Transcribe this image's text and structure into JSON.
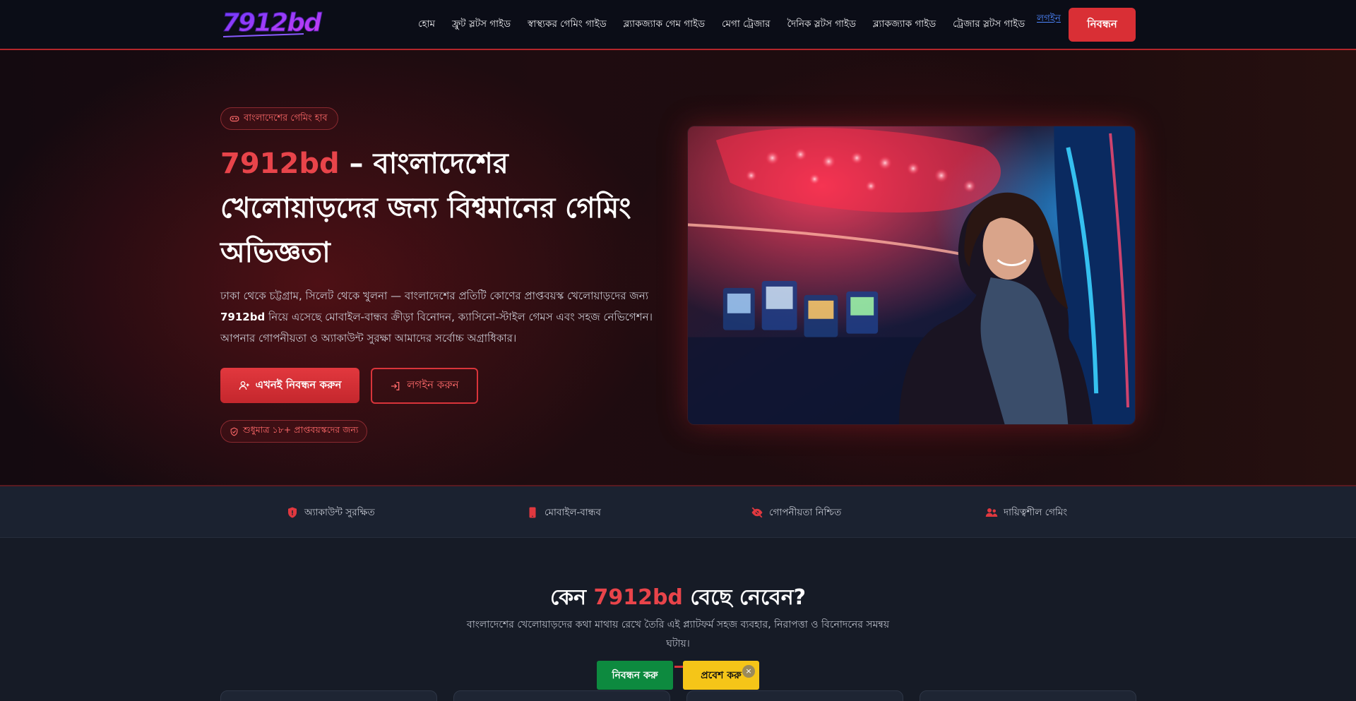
{
  "brand": {
    "logo_text": "7912bd",
    "colors": {
      "accent": "#d92f35",
      "logo_start": "#7a3cff",
      "logo_end": "#c23bff"
    }
  },
  "nav": {
    "links": [
      "হোম",
      "ফ্রুট স্লটস গাইড",
      "স্বাস্থ্যকর গেমিং গাইড",
      "ব্ল্যাকজ্যাক গেম গাইড",
      "মেগা ট্রেজার",
      "দৈনিক স্লটস গাইড",
      "ব্ল্যাকজ্যাক গাইড",
      "ট্রেজার স্লটস গাইড"
    ],
    "login_label": "লগইন",
    "register_label": "নিবন্ধন"
  },
  "hero": {
    "badge": "বাংলাদেশের গেমিং হাব",
    "badge_icon": "gamepad-icon",
    "title_brand": "7912bd",
    "title_rest_1": " – বাংলাদেশের",
    "title_rest_2": "খেলোয়াড়দের জন্য বিশ্বমানের গেমিং",
    "title_rest_3": "অভিজ্ঞতা",
    "desc_before": "ঢাকা থেকে চট্টগ্রাম, সিলেট থেকে খুলনা — বাংলাদেশের প্রতিটি কোণের প্রাপ্তবয়স্ক খেলোয়াড়দের জন্য ",
    "desc_brand": "7912bd",
    "desc_after": " নিয়ে এসেছে মোবাইল-বান্ধব ক্রীড়া বিনোদন, ক্যাসিনো-স্টাইল গেমস এবং সহজ নেভিগেশন। আপনার গোপনীয়তা ও অ্যাকাউন্ট সুরক্ষা আমাদের সর্বোচ্চ অগ্রাধিকার।",
    "primary_button": "এখনই নিবন্ধন করুন",
    "outline_button": "লগইন করুন",
    "age_badge": "শুধুমাত্র ১৮+ প্রাপ্তবয়স্কদের জন্য"
  },
  "features": [
    {
      "label": "অ্যাকাউন্ট সুরক্ষিত",
      "icon": "shield-icon"
    },
    {
      "label": "মোবাইল-বান্ধব",
      "icon": "mobile-icon"
    },
    {
      "label": "গোপনীয়তা নিশ্চিত",
      "icon": "eye-slash-icon"
    },
    {
      "label": "দায়িত্বশীল গেমিং",
      "icon": "users-icon"
    }
  ],
  "why": {
    "title_before": "কেন ",
    "title_brand": "7912bd",
    "title_after": " বেছে নেবেন?",
    "subtitle": "বাংলাদেশের খেলোয়াড়দের কথা মাথায় রেখে তৈরি এই প্ল্যাটফর্ম সহজ ব্যবহার, নিরাপত্তা ও বিনোদনের সমন্বয় ঘটায়।"
  },
  "floating_bar": {
    "register_label": "নিবন্ধন করু",
    "login_label": "প্রবেশ করু",
    "close_label": "×"
  }
}
